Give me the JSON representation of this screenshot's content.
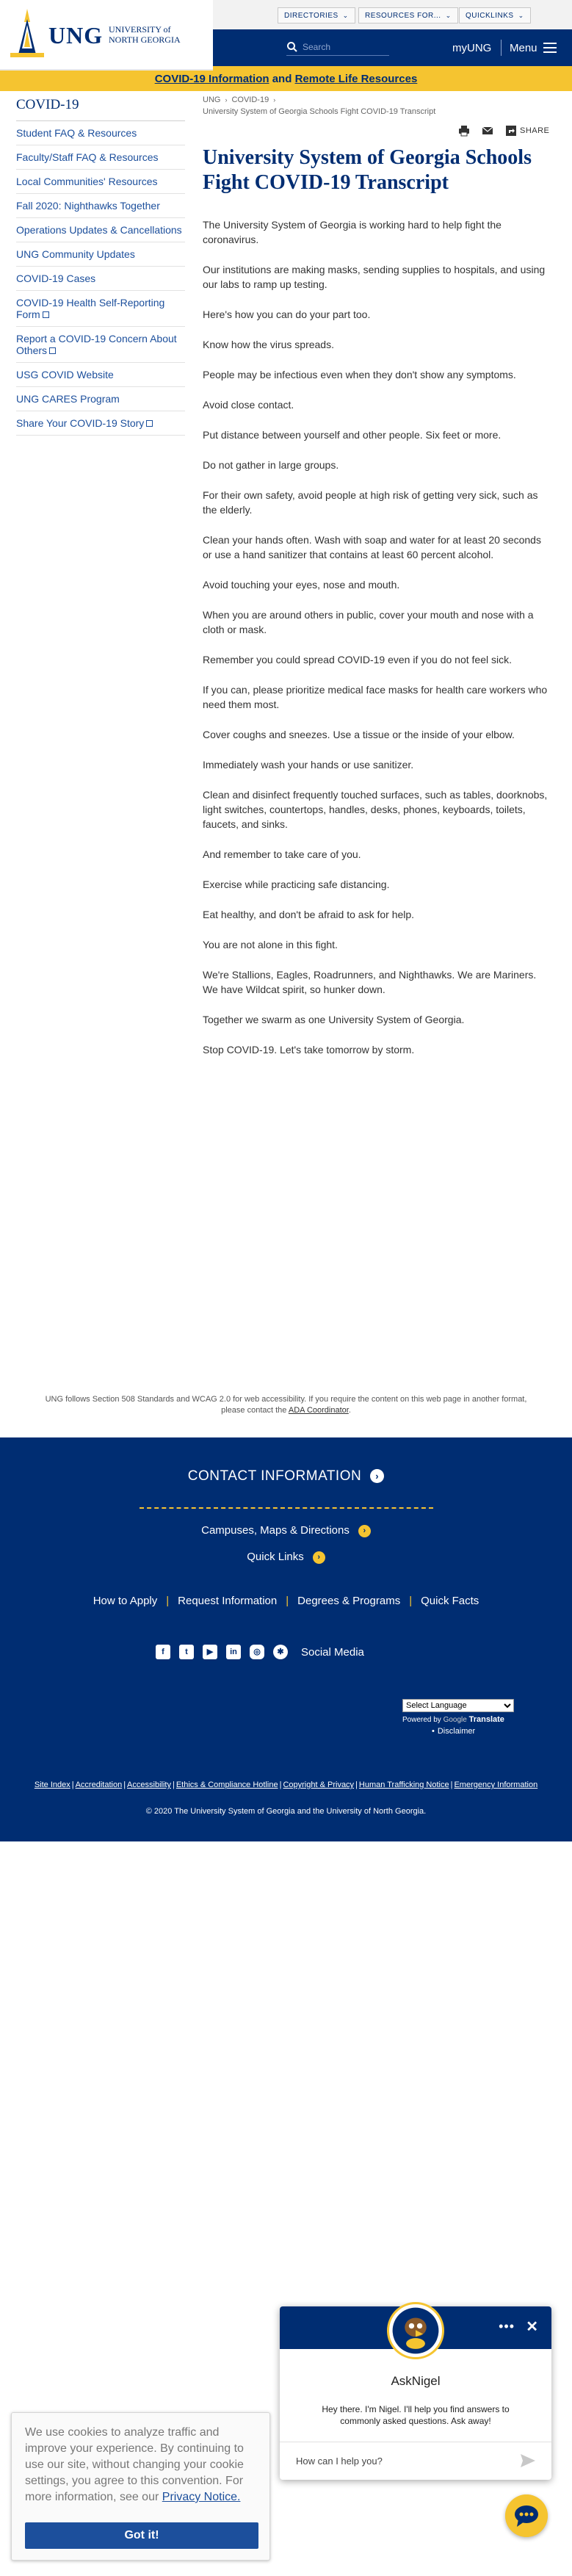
{
  "header": {
    "logo_abbr": "UNG",
    "logo_name_line1": "UNIVERSITY of",
    "logo_name_line2": "NORTH GEORGIA",
    "utility": [
      "DIRECTORIES",
      "RESOURCES FOR...",
      "QUICKLINKS"
    ],
    "search_placeholder": "Search",
    "myung": "myUNG",
    "menu": "Menu"
  },
  "banner": {
    "link1": "COVID-19 Information",
    "and": "and",
    "link2": "Remote Life Resources"
  },
  "sidebar": {
    "title": "COVID-19",
    "items": [
      {
        "label": "Student FAQ & Resources"
      },
      {
        "label": "Faculty/Staff FAQ & Resources"
      },
      {
        "label": "Local Communities' Resources"
      },
      {
        "label": "Fall 2020: Nighthawks Together"
      },
      {
        "label": "Operations Updates & Cancellations"
      },
      {
        "label": "UNG Community Updates"
      },
      {
        "label": "COVID-19 Cases"
      },
      {
        "label": "COVID-19 Health Self-Reporting Form"
      },
      {
        "label": "Report a COVID-19 Concern About Others"
      },
      {
        "label": "USG COVID Website"
      },
      {
        "label": "UNG CARES Program"
      },
      {
        "label": "Share Your COVID-19 Story"
      }
    ]
  },
  "breadcrumb": {
    "home": "UNG",
    "section": "COVID-19",
    "current": "University System of Georgia Schools Fight COVID-19 Transcript"
  },
  "tools": {
    "share": "SHARE",
    "print_icon": "print-icon",
    "email_icon": "email-icon",
    "share_icon": "share-icon"
  },
  "article": {
    "title": "University System of Georgia Schools Fight COVID-19 Transcript",
    "paragraphs": [
      "The University System of Georgia is working hard to help fight the coronavirus.",
      "Our institutions are making masks, sending supplies to hospitals, and using our labs to ramp up testing.",
      "Here's how you can do your part too.",
      "Know how the virus spreads.",
      "People may be infectious even when they don't show any symptoms.",
      "Avoid close contact.",
      "Put distance between yourself and other people. Six feet or more.",
      "Do not gather in large groups.",
      "For their own safety, avoid people at high risk of getting very sick, such as the elderly.",
      "Clean your hands often. Wash with soap and water for at least 20 seconds or use a hand sanitizer that contains at least 60 percent alcohol.",
      "Avoid touching your eyes, nose and mouth.",
      "When you are around others in public, cover your mouth and nose with a cloth or mask.",
      "Remember you could spread COVID-19 even if you do not feel sick.",
      "If you can, please prioritize medical face masks for health care workers who need them most.",
      "Cover coughs and sneezes. Use a tissue or the inside of your elbow.",
      "Immediately wash your hands or use sanitizer.",
      "Clean and disinfect frequently touched surfaces, such as tables, doorknobs, light switches, countertops, handles, desks, phones, keyboards, toilets, faucets, and sinks.",
      "And remember to take care of you.",
      "Exercise while practicing safe distancing.",
      "Eat healthy, and don't be afraid to ask for help.",
      "You are not alone in this fight.",
      "We're Stallions, Eagles, Roadrunners, and Nighthawks. We are Mariners. We have Wildcat spirit, so hunker down.",
      "Together we swarm as one University System of Georgia.",
      "Stop COVID-19. Let's take tomorrow by storm."
    ]
  },
  "accessibility": {
    "line1": "UNG follows Section 508 Standards and WCAG 2.0 for web accessibility. If you require the content on this web page in another format,",
    "line2_prefix": "please contact the",
    "link": "ADA Coordinator",
    "line2_suffix": "."
  },
  "footer": {
    "contact": "CONTACT INFORMATION",
    "campuses": "Campuses, Maps & Directions",
    "quicklinks": "Quick Links",
    "links": [
      "How to Apply",
      "Request Information",
      "Degrees & Programs",
      "Quick Facts"
    ],
    "social_label": "Social Media",
    "social_icons": [
      "facebook-icon",
      "twitter-icon",
      "youtube-icon",
      "linkedin-icon",
      "instagram-icon",
      "more-social-icon"
    ],
    "language_select": "Select Language",
    "powered_by": "Powered by",
    "google": "Google",
    "translate": "Translate",
    "disclaimer": "Disclaimer",
    "legal_links": [
      "Site Index",
      "Accreditation",
      "Accessibility",
      "Ethics & Compliance Hotline",
      "Copyright & Privacy",
      "Human Trafficking Notice",
      "Emergency Information"
    ],
    "copyright": "© 2020 The University System of Georgia and the University of North Georgia."
  },
  "chat": {
    "name": "AskNigel",
    "message": "Hey there. I'm Nigel. I'll help you find answers to commonly asked questions. Ask away!",
    "placeholder": "How can I help you?",
    "menu_dots": "•••",
    "close": "✕"
  },
  "cookie": {
    "text": "We use cookies to analyze traffic and improve your experience. By continuing to use our site, without changing your cookie settings, you agree to this convention. For more information, see our",
    "link": "Privacy Notice.",
    "button": "Got it!"
  },
  "colors": {
    "navy": "#002d72",
    "gold": "#f5c430",
    "link_blue": "#1c4f9c"
  }
}
